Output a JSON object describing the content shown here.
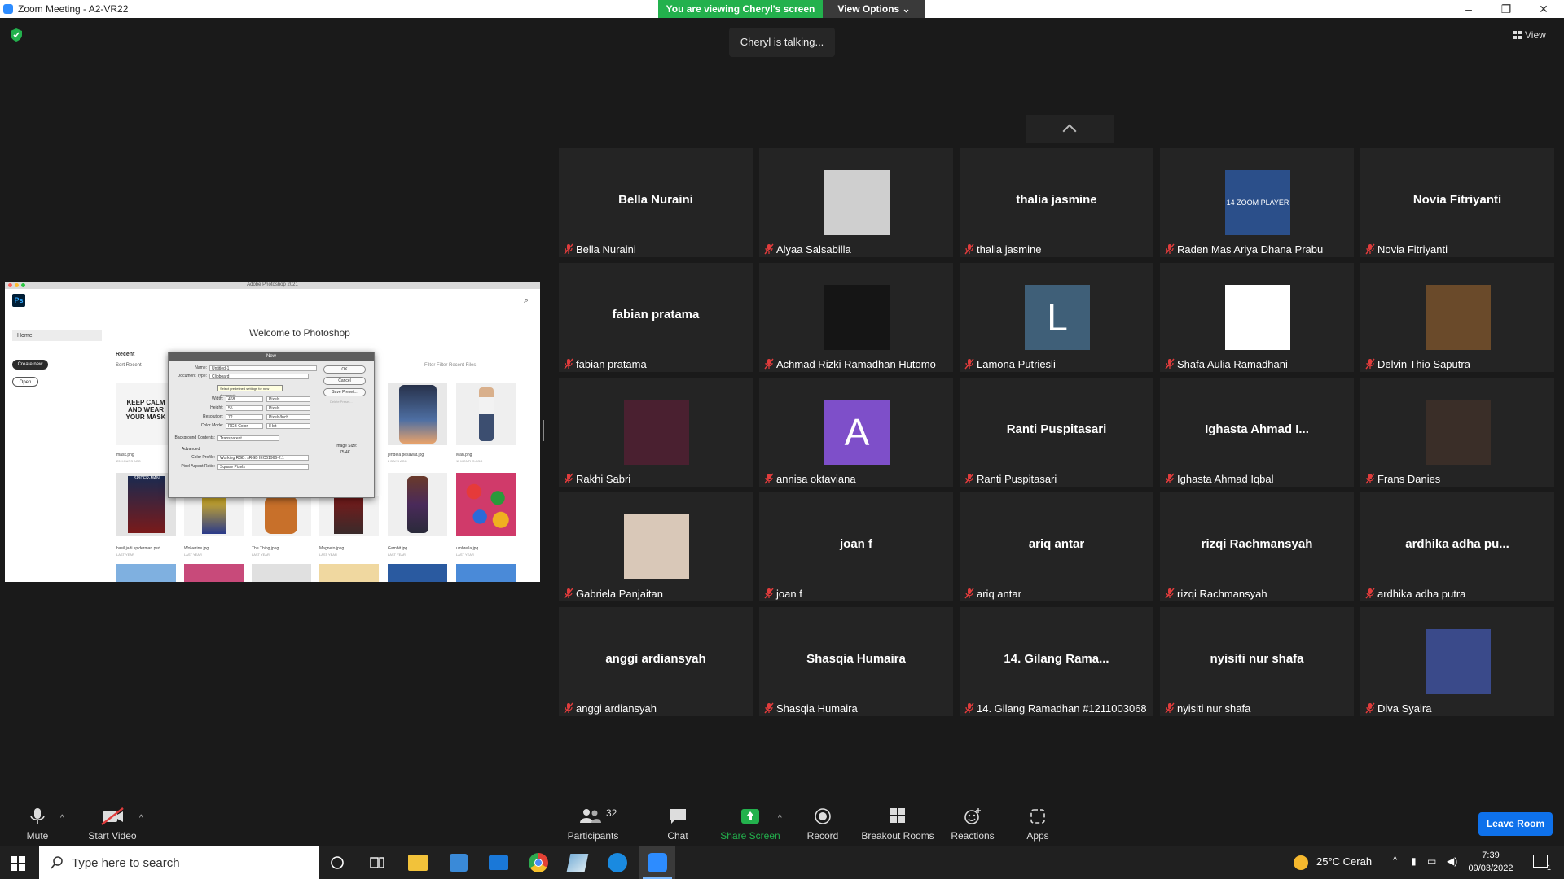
{
  "window": {
    "title": "Zoom Meeting - A2-VR22",
    "minimize": "–",
    "maximize": "❐",
    "close": "✕"
  },
  "banner": {
    "viewing": "You are viewing Cheryl's screen",
    "view_options": "View Options ⌄"
  },
  "talking": "Cheryl is talking...",
  "view_button": "View",
  "shared_screen": {
    "app_title": "Adobe Photoshop 2021",
    "ps_logo": "Ps",
    "home": "Home",
    "create_new": "Create new",
    "open": "Open",
    "welcome": "Welcome to Photoshop",
    "recent": "Recent",
    "sort": "Sort  Recent",
    "filter": "Filter   Filter Recent Files",
    "thumbs": [
      {
        "name": "mask.png",
        "sub": "23 HOURS AGO",
        "caption": "KEEP CALM AND WEAR YOUR MASK"
      },
      {
        "name": "jendela pesawat.jpg",
        "sub": "2 DAYS AGO",
        "caption": ""
      },
      {
        "name": "Man.png",
        "sub": "11 MONTHS AGO",
        "caption": ""
      },
      {
        "name": "hasil jadi spiderman.psd",
        "sub": "LAST YEAR",
        "caption": "SPIDER-MAN"
      },
      {
        "name": "Wolverine.jpg",
        "sub": "LAST YEAR",
        "caption": ""
      },
      {
        "name": "The Thing.jpeg",
        "sub": "LAST YEAR",
        "caption": ""
      },
      {
        "name": "Magneto.jpeg",
        "sub": "LAST YEAR",
        "caption": ""
      },
      {
        "name": "Gambit.jpg",
        "sub": "LAST YEAR",
        "caption": ""
      },
      {
        "name": "umbrella.jpg",
        "sub": "LAST YEAR",
        "caption": ""
      }
    ],
    "dialog": {
      "title": "New",
      "name_label": "Name:",
      "name_value": "Untitled-1",
      "doctype_label": "Document Type:",
      "doctype_value": "Clipboard",
      "tooltip": "Select predefined settings for new documents",
      "width_label": "Width:",
      "width_value": "468",
      "width_unit": "Pixels",
      "height_label": "Height:",
      "height_value": "55",
      "height_unit": "Pixels",
      "res_label": "Resolution:",
      "res_value": "72",
      "res_unit": "Pixels/Inch",
      "mode_label": "Color Mode:",
      "mode_value": "RGB Color",
      "mode_bits": "8 bit",
      "bg_label": "Background Contents:",
      "bg_value": "Transparent",
      "advanced": "Advanced",
      "profile_label": "Color Profile:",
      "profile_value": "Working RGB: sRGB IEC61966-2.1",
      "aspect_label": "Pixel Aspect Ratio:",
      "aspect_value": "Square Pixels",
      "ok": "OK",
      "cancel": "Cancel",
      "save_preset": "Save Preset...",
      "delete_preset": "Delete Preset...",
      "image_size_label": "Image Size:",
      "image_size_value": "75,4K"
    }
  },
  "participants_grid": [
    {
      "display": "Bella Nuraini",
      "name": "Bella Nuraini",
      "kind": "text"
    },
    {
      "display": "",
      "name": "Alyaa Salsabilla",
      "kind": "photo",
      "color": "#cfcfcf"
    },
    {
      "display": "thalia jasmine",
      "name": "thalia jasmine",
      "kind": "text"
    },
    {
      "display": "14 ZOOM PLAYER",
      "name": "Raden Mas Ariya Dhana Prabu",
      "kind": "photo",
      "color": "#2b4f8a"
    },
    {
      "display": "Novia Fitriyanti",
      "name": "Novia Fitriyanti",
      "kind": "text"
    },
    {
      "display": "fabian pratama",
      "name": "fabian pratama",
      "kind": "text"
    },
    {
      "display": "",
      "name": "Achmad Rizki Ramadhan Hutomo",
      "kind": "photo",
      "color": "#151515"
    },
    {
      "display": "L",
      "name": "Lamona Putriesli",
      "kind": "letter",
      "color": "#3f5f78"
    },
    {
      "display": "",
      "name": "Shafa Aulia Ramadhani",
      "kind": "photo",
      "color": "#ffffff"
    },
    {
      "display": "",
      "name": "Delvin Thio Saputra",
      "kind": "photo",
      "color": "#6a4a2a"
    },
    {
      "display": "",
      "name": "Rakhi Sabri",
      "kind": "photo",
      "color": "#4a2030"
    },
    {
      "display": "A",
      "name": "annisa oktaviana",
      "kind": "letter",
      "color": "#7e4fc9"
    },
    {
      "display": "Ranti Puspitasari",
      "name": "Ranti Puspitasari",
      "kind": "text"
    },
    {
      "display": "Ighasta Ahmad I...",
      "name": "Ighasta Ahmad Iqbal",
      "kind": "text"
    },
    {
      "display": "",
      "name": "Frans Danies",
      "kind": "photo",
      "color": "#3a2e28"
    },
    {
      "display": "",
      "name": "Gabriela Panjaitan",
      "kind": "photo",
      "color": "#d9c8b8"
    },
    {
      "display": "joan f",
      "name": "joan f",
      "kind": "text"
    },
    {
      "display": "ariq antar",
      "name": "ariq antar",
      "kind": "text"
    },
    {
      "display": "rizqi Rachmansyah",
      "name": "rizqi Rachmansyah",
      "kind": "text"
    },
    {
      "display": "ardhika adha pu...",
      "name": "ardhika adha putra",
      "kind": "text"
    },
    {
      "display": "anggi ardiansyah",
      "name": "anggi ardiansyah",
      "kind": "text"
    },
    {
      "display": "Shasqia Humaira",
      "name": "Shasqia Humaira",
      "kind": "text"
    },
    {
      "display": "14. Gilang Rama...",
      "name": "14. Gilang Ramadhan #1211003068",
      "kind": "text"
    },
    {
      "display": "nyisiti nur shafa",
      "name": "nyisiti nur shafa",
      "kind": "text"
    },
    {
      "display": "",
      "name": "Diva Syaira",
      "kind": "photo",
      "color": "#3a4a8a"
    }
  ],
  "toolbar": {
    "mute": "Mute",
    "start_video": "Start Video",
    "participants": "Participants",
    "participants_count": "32",
    "chat": "Chat",
    "share_screen": "Share Screen",
    "record": "Record",
    "breakout": "Breakout Rooms",
    "reactions": "Reactions",
    "apps": "Apps",
    "leave": "Leave Room"
  },
  "taskbar": {
    "search_placeholder": "Type here to search",
    "weather": "25°C  Cerah",
    "time": "7:39",
    "date": "09/03/2022",
    "notif_count": "1"
  }
}
